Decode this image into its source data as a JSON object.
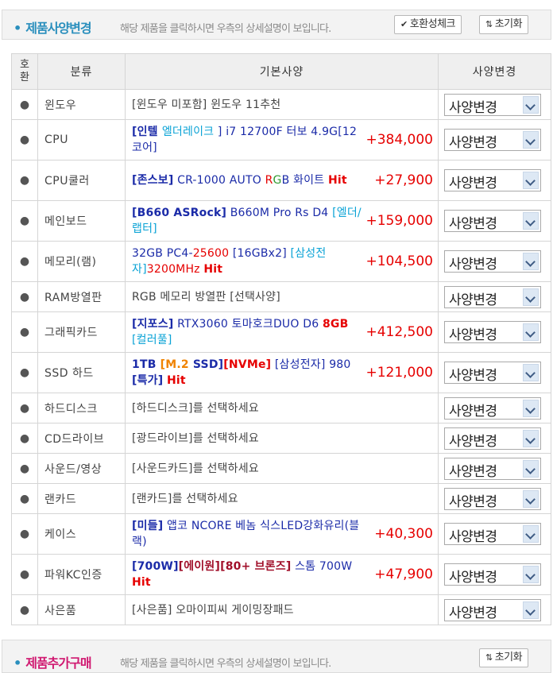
{
  "spec_header": {
    "title": "제품사양변경",
    "subtitle": "해당 제품을 클릭하시면 우측의 상세설명이 보입니다.",
    "compat_button": "호환성체크",
    "reset_button": "초기화"
  },
  "table": {
    "headers": [
      "호환",
      "분류",
      "기본사양",
      "사양변경"
    ],
    "select_label": "사양변경",
    "rows": [
      {
        "category": "윈도우",
        "spec": [
          [
            "[윈도우 미포함] 윈도우 11추천",
            ""
          ]
        ],
        "price": ""
      },
      {
        "category": "CPU",
        "spec": [
          [
            "[인텔 ",
            "navy"
          ],
          [
            "엘더레이크",
            "cyan"
          ],
          [
            " ] i7 12700F 터보 4.9G[12코어]",
            "navyn"
          ]
        ],
        "price": "+384,000"
      },
      {
        "category": "CPU쿨러",
        "spec": [
          [
            "[존스보]",
            "navy"
          ],
          [
            " CR-1000 AUTO ",
            "navyn"
          ],
          [
            "R",
            "red"
          ],
          [
            "G",
            "green"
          ],
          [
            "B 화이트 ",
            "navyn"
          ],
          [
            "Hit",
            "redb"
          ]
        ],
        "price": "+27,900"
      },
      {
        "category": "메인보드",
        "spec": [
          [
            "[B660 ASRock]",
            "navy"
          ],
          [
            " B660M Pro Rs D4 ",
            "navyn"
          ],
          [
            "[엘더/랩터]",
            "cyan"
          ]
        ],
        "price": "+159,000"
      },
      {
        "category": "메모리(램)",
        "spec": [
          [
            "32GB PC4-",
            "navyn"
          ],
          [
            "25600",
            "red"
          ],
          [
            " [16GBx2] ",
            "navyn"
          ],
          [
            "[삼성전자]",
            "cyan"
          ],
          [
            "3200MHz ",
            "red"
          ],
          [
            "Hit",
            "redb"
          ]
        ],
        "price": "+104,500"
      },
      {
        "category": "RAM방열판",
        "spec": [
          [
            "RGB 메모리 방열판 [선택사양]",
            ""
          ]
        ],
        "price": ""
      },
      {
        "category": "그래픽카드",
        "spec": [
          [
            "[지포스]",
            "navy"
          ],
          [
            " RTX3060 토마호크DUO D6 ",
            "navyn"
          ],
          [
            "8GB",
            "redb"
          ],
          [
            " ",
            ""
          ],
          [
            "[컬러풀]",
            "cyan"
          ]
        ],
        "price": "+412,500"
      },
      {
        "category": "SSD 하드",
        "spec": [
          [
            "1TB ",
            "navy"
          ],
          [
            "[M.2 ",
            "orange"
          ],
          [
            "SSD]",
            "navy"
          ],
          [
            "[NVMe]",
            "redb"
          ],
          [
            " [삼성전자] 980 ",
            "navyn"
          ],
          [
            "[특가]",
            "navy"
          ],
          [
            " ",
            ""
          ],
          [
            "Hit",
            "redb"
          ]
        ],
        "price": "+121,000"
      },
      {
        "category": "하드디스크",
        "spec": [
          [
            "[하드디스크]를 선택하세요",
            ""
          ]
        ],
        "price": ""
      },
      {
        "category": "CD드라이브",
        "spec": [
          [
            "[광드라이브]를 선택하세요",
            ""
          ]
        ],
        "price": ""
      },
      {
        "category": "사운드/영상",
        "spec": [
          [
            "[사운드카드]를 선택하세요",
            ""
          ]
        ],
        "price": ""
      },
      {
        "category": "랜카드",
        "spec": [
          [
            "[랜카드]를 선택하세요",
            ""
          ]
        ],
        "price": ""
      },
      {
        "category": "케이스",
        "spec": [
          [
            "[미들]",
            "navy"
          ],
          [
            " 앱코 NCORE 베놈 식스LED강화유리(블랙)",
            "navyn"
          ]
        ],
        "price": "+40,300"
      },
      {
        "category": "파워KC인증",
        "spec": [
          [
            "[700W]",
            "navy"
          ],
          [
            "[에이원]",
            "maroon"
          ],
          [
            "[80+ 브론즈]",
            "maroon"
          ],
          [
            " 스톰 700W ",
            "navyn"
          ],
          [
            "Hit",
            "redb"
          ]
        ],
        "price": "+47,900"
      },
      {
        "category": "사은품",
        "spec": [
          [
            "[사은품] 오마이피씨 게이밍장패드",
            ""
          ]
        ],
        "price": ""
      }
    ]
  },
  "extra_header": {
    "title": "제품추가구매",
    "subtitle": "해당 제품을 클릭하시면 우측의 상세설명이 보입니다.",
    "reset_button": "초기화"
  },
  "colors": {
    "title_blue": "#2a8fbd",
    "extra_title": "#d01870",
    "price_red": "#e60000",
    "navy": "#1b2ba8",
    "cyan": "#0ba3d6"
  },
  "icons": [
    "check-icon",
    "reset-arrows-icon",
    "bullet-icon",
    "dropdown-arrow-icon"
  ]
}
